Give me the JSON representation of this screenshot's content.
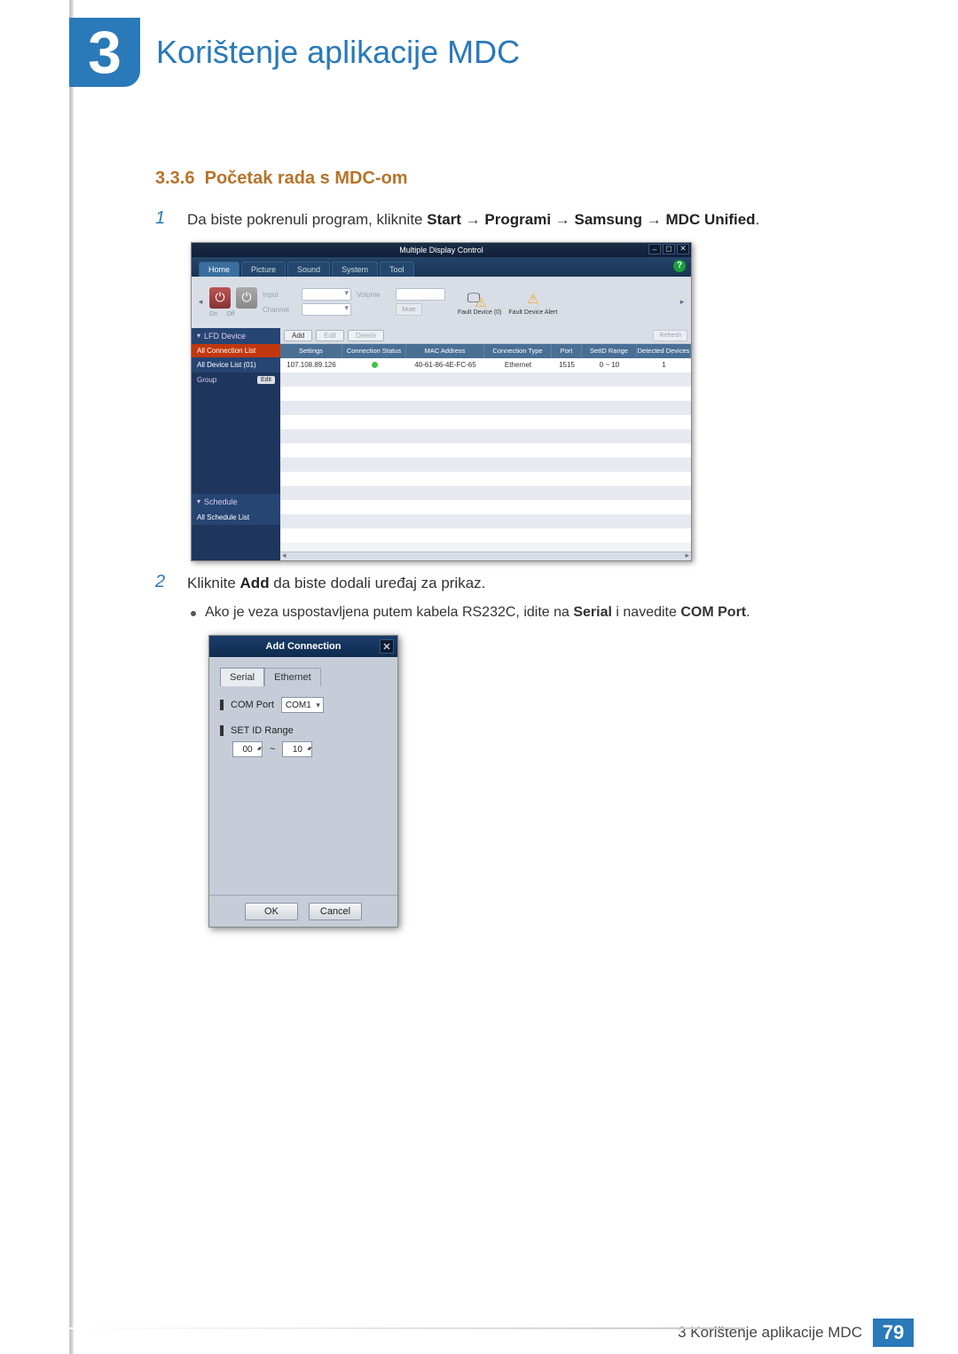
{
  "chapter": {
    "number": "3",
    "title": "Korištenje aplikacije MDC"
  },
  "section": {
    "number": "3.3.6",
    "title": "Početak rada s MDC-om"
  },
  "steps": {
    "s1": {
      "num": "1",
      "pre": "Da biste pokrenuli program, kliknite ",
      "b1": "Start",
      "a1": " → ",
      "b2": "Programi",
      "a2": " → ",
      "b3": "Samsung",
      "a3": " → ",
      "b4": "MDC Unified",
      "post": "."
    },
    "s2": {
      "num": "2",
      "pre": "Kliknite ",
      "b1": "Add",
      "post": " da biste dodali uređaj za prikaz."
    },
    "bullet": {
      "pre": "Ako je veza uspostavljena putem kabela RS232C, idite na ",
      "b1": "Serial",
      "mid": " i navedite ",
      "b2": "COM Port",
      "post": "."
    }
  },
  "mdc": {
    "title": "Multiple Display Control",
    "win": {
      "min": "–",
      "max": "◻",
      "close": "✕"
    },
    "tabs": [
      "Home",
      "Picture",
      "Sound",
      "System",
      "Tool"
    ],
    "help": "?",
    "toolbar": {
      "on": "On",
      "off": "Off",
      "input": "Input",
      "channel": "Channel",
      "volume": "Volume",
      "mute": "Mute",
      "fault0": "Fault Device (0)",
      "faultA": "Fault Device Alert"
    },
    "side": {
      "lfd": "LFD Device",
      "conn": "All Connection List",
      "all": "All Device List (01)",
      "group": "Group",
      "edit": "Edit",
      "sched": "Schedule",
      "schedall": "All Schedule List"
    },
    "main": {
      "add": "Add",
      "edit": "Edit",
      "delete": "Delete",
      "refresh": "Refresh",
      "cols": {
        "settings": "Settings",
        "status": "Connection Status",
        "mac": "MAC Address",
        "type": "Connection Type",
        "port": "Port",
        "sid": "SetID Range",
        "det": "Detected Devices"
      },
      "row": {
        "ip": "107.108.89.126",
        "mac": "40-61-86-4E-FC-65",
        "type": "Ethernet",
        "port": "1515",
        "sid": "0 ~ 10",
        "det": "1"
      }
    }
  },
  "dialog": {
    "title": "Add Connection",
    "close": "✕",
    "tabs": {
      "serial": "Serial",
      "eth": "Ethernet"
    },
    "com_label": "COM Port",
    "com_val": "COM1",
    "sid_label": "SET ID Range",
    "sid_from": "00",
    "sid_sep": "~",
    "sid_to": "10",
    "ok": "OK",
    "cancel": "Cancel"
  },
  "footer": {
    "text": "3 Korištenje aplikacije MDC",
    "page": "79"
  }
}
